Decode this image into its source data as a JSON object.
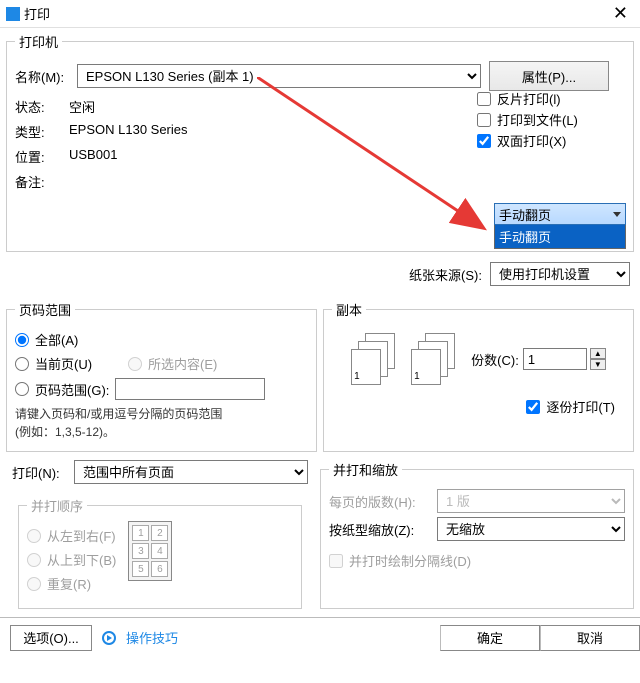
{
  "title": "打印",
  "printer": {
    "legend": "打印机",
    "name_label": "名称(M):",
    "name_value": "EPSON L130 Series (副本 1)",
    "props_btn": "属性(P)...",
    "status_label": "状态:",
    "status_value": "空闲",
    "type_label": "类型:",
    "type_value": "EPSON L130 Series",
    "where_label": "位置:",
    "where_value": "USB001",
    "comment_label": "备注:",
    "reverse": "反片打印(l)",
    "to_file": "打印到文件(L)",
    "duplex": "双面打印(X)",
    "manual_flip": "手动翻页"
  },
  "source": {
    "label": "纸张来源(S):",
    "value": "使用打印机设置"
  },
  "page_range": {
    "legend": "页码范围",
    "all": "全部(A)",
    "current": "当前页(U)",
    "selection": "所选内容(E)",
    "pages": "页码范围(G):",
    "hint1": "请键入页码和/或用逗号分隔的页码范围",
    "hint2": "(例如：1,3,5-12)。"
  },
  "copies": {
    "legend": "副本",
    "count_label": "份数(C):",
    "count_value": "1",
    "collate": "逐份打印(T)"
  },
  "print_what": {
    "label": "打印(N):",
    "value": "范围中所有页面"
  },
  "print_order": {
    "legend": "并打顺序",
    "lr": "从左到右(F)",
    "tb": "从上到下(B)",
    "repeat": "重复(R)"
  },
  "zoom": {
    "legend": "并打和缩放",
    "pps_label": "每页的版数(H):",
    "pps_value": "1 版",
    "scale_label": "按纸型缩放(Z):",
    "scale_value": "无缩放",
    "sep": "并打时绘制分隔线(D)"
  },
  "bottom": {
    "options": "选项(O)...",
    "tips": "操作技巧",
    "ok": "确定",
    "cancel": "取消"
  }
}
